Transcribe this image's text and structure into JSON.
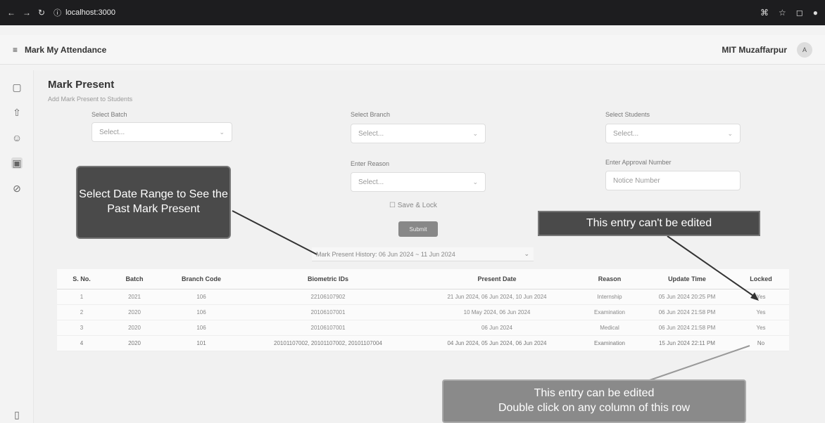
{
  "browser": {
    "url": "localhost:3000"
  },
  "header": {
    "app_title": "Mark My Attendance",
    "org": "MIT Muzaffarpur",
    "avatar": "A"
  },
  "page": {
    "title": "Mark Present",
    "subtitle": "Add Mark Present to Students"
  },
  "form": {
    "batch_label": "Select Batch",
    "batch_value": "Select...",
    "branch_label": "Select Branch",
    "branch_value": "Select...",
    "students_label": "Select Students",
    "students_value": "Select...",
    "reason_label": "Enter Reason",
    "reason_value": "Select...",
    "approval_label": "Enter Approval Number",
    "approval_placeholder": "Notice Number",
    "save_lock": "Save & Lock",
    "submit": "Submit"
  },
  "history": {
    "range": "Mark Present History: 06 Jun 2024 ~ 11 Jun 2024"
  },
  "table": {
    "headers": [
      "S. No.",
      "Batch",
      "Branch Code",
      "Biometric IDs",
      "Present Date",
      "Reason",
      "Update Time",
      "Locked"
    ],
    "rows": [
      [
        "1",
        "2021",
        "106",
        "22106107902",
        "21 Jun 2024, 06 Jun 2024, 10 Jun 2024",
        "Internship",
        "05 Jun 2024 20:25 PM",
        "Yes"
      ],
      [
        "2",
        "2020",
        "106",
        "20106107001",
        "10 May 2024, 06 Jun 2024",
        "Examination",
        "06 Jun 2024 21:58 PM",
        "Yes"
      ],
      [
        "3",
        "2020",
        "106",
        "20106107001",
        "06 Jun 2024",
        "Medical",
        "06 Jun 2024 21:58 PM",
        "Yes"
      ],
      [
        "4",
        "2020",
        "101",
        "20101107002, 20101107002, 20101107004",
        "04 Jun 2024, 05 Jun 2024, 06 Jun 2024",
        "Examination",
        "15 Jun 2024 22:11 PM",
        "No"
      ]
    ]
  },
  "callouts": {
    "date_range": "Select Date Range to See the Past Mark Present",
    "locked": "This entry can't be edited",
    "editable_line1": "This entry can be edited",
    "editable_line2": "Double click on any column of this row"
  }
}
